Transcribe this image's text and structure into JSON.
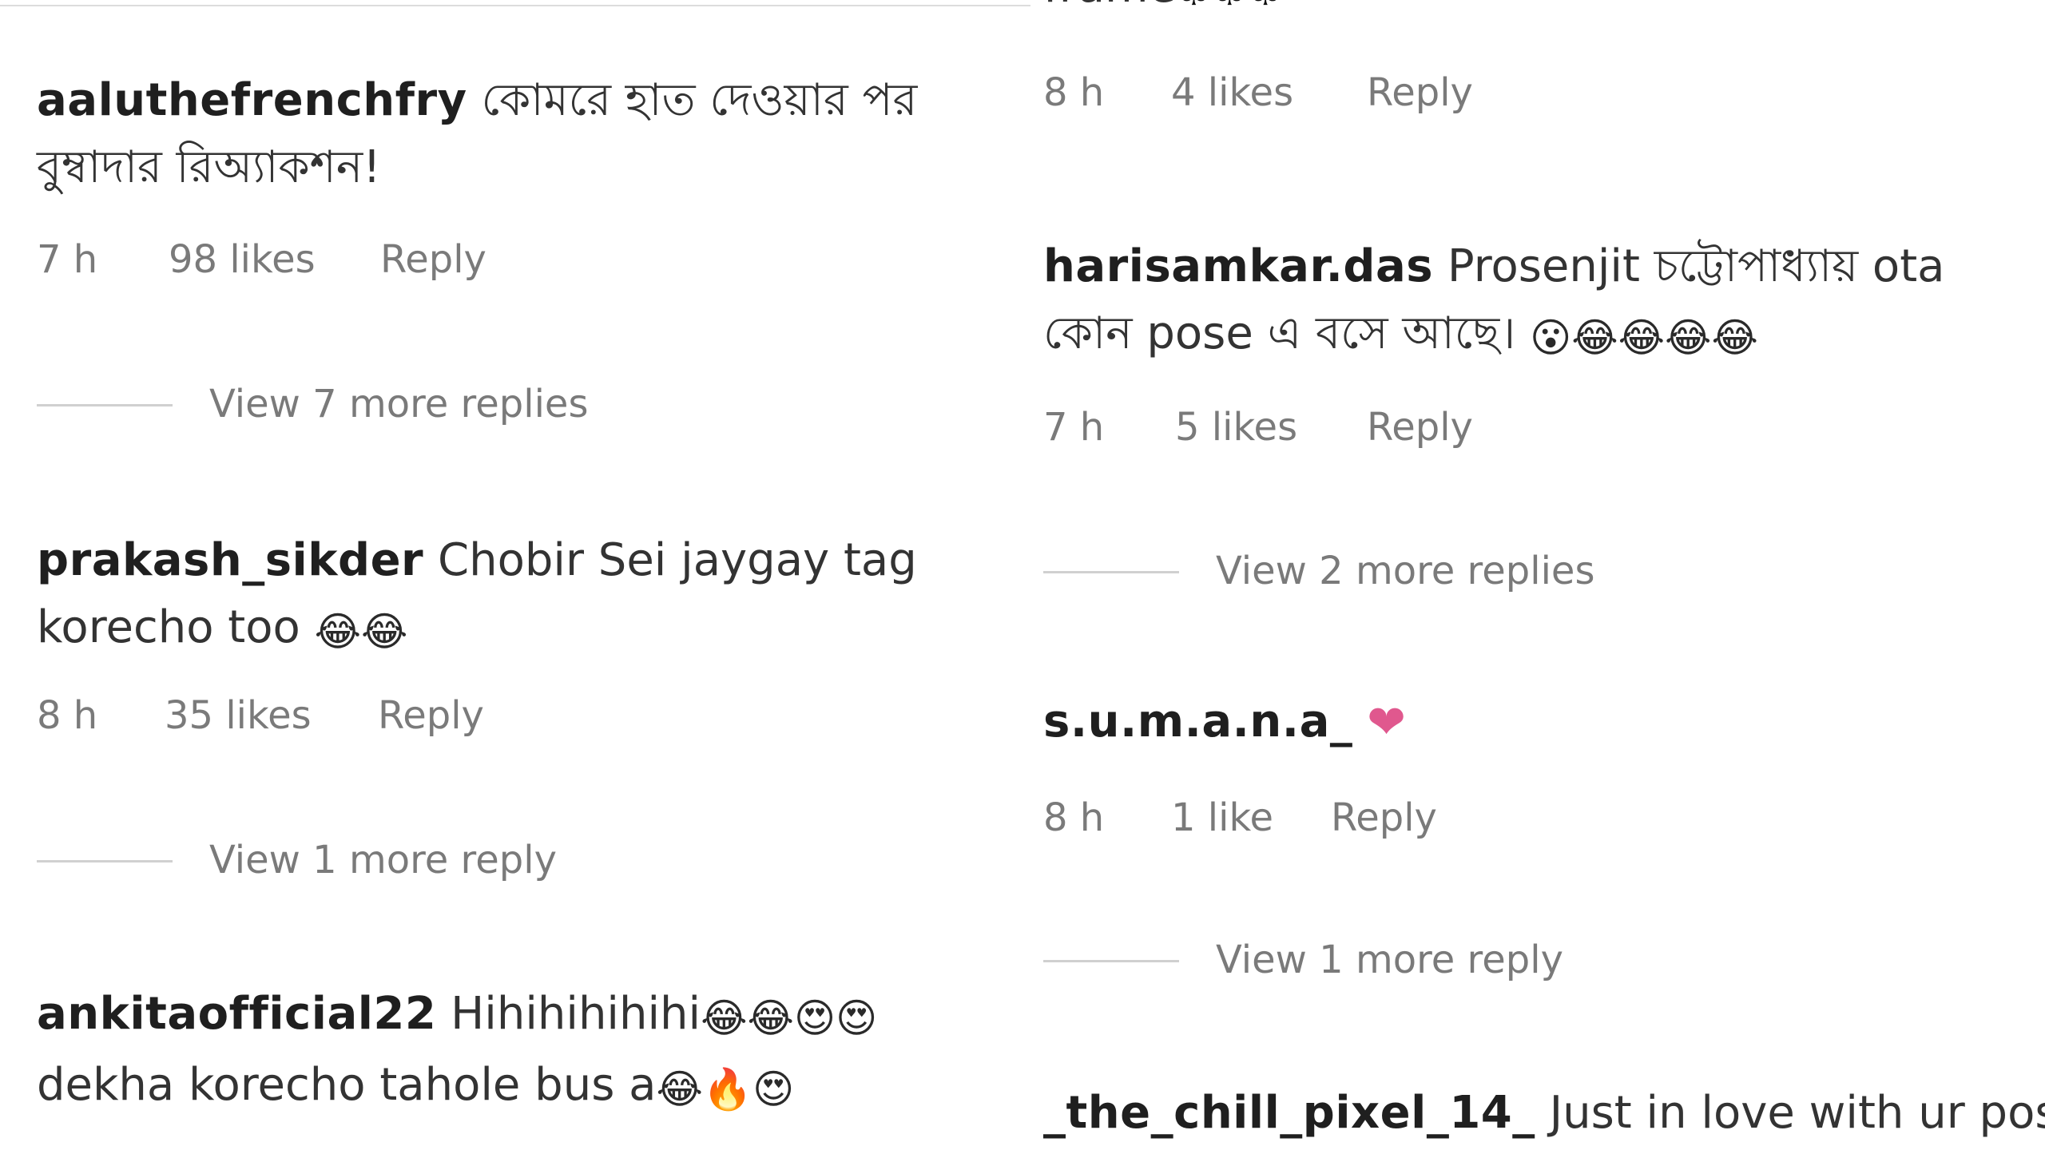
{
  "left": {
    "comment1": {
      "user": "aaluthefrenchfry",
      "text": "কোমরে হাত দেওয়ার পর বুম্বাদার রিঅ্যাকশন!",
      "time": "7 h",
      "likes": "98 likes",
      "reply": "Reply",
      "view_more": "View 7 more replies"
    },
    "comment2": {
      "user": "prakash_sikder",
      "text": "Chobir Sei jaygay tag korecho too",
      "emojis": "😂😂",
      "time": "8 h",
      "likes": "35 likes",
      "reply": "Reply",
      "view_more": "View 1 more reply"
    },
    "comment3": {
      "user": "ankitaofficial22",
      "text1": "Hihihihihihi",
      "emojis1": "😂😂😍😍",
      "text2": "dekha korecho tahole bus a",
      "emojis2": "😂🔥😍"
    }
  },
  "right": {
    "comment0": {
      "text": "frame",
      "emojis": "♣♣♣",
      "time": "8 h",
      "likes": "4 likes",
      "reply": "Reply"
    },
    "comment1": {
      "user": "harisamkar.das",
      "text": "Prosenjit চট্টোপাধ্যায় ota কোন pose এ বসে আছে।",
      "emojis": "😮😂😂😂😂",
      "time": "7 h",
      "likes": "5 likes",
      "reply": "Reply",
      "view_more": "View 2 more replies"
    },
    "comment2": {
      "user": "s.u.m.a.n.a_",
      "emoji": "❤",
      "time": "8 h",
      "likes": "1 like",
      "reply": "Reply",
      "view_more": "View 1 more reply"
    },
    "comment3": {
      "user": "_the_chill_pixel_14_",
      "text": "Just in love with ur posts n"
    }
  }
}
